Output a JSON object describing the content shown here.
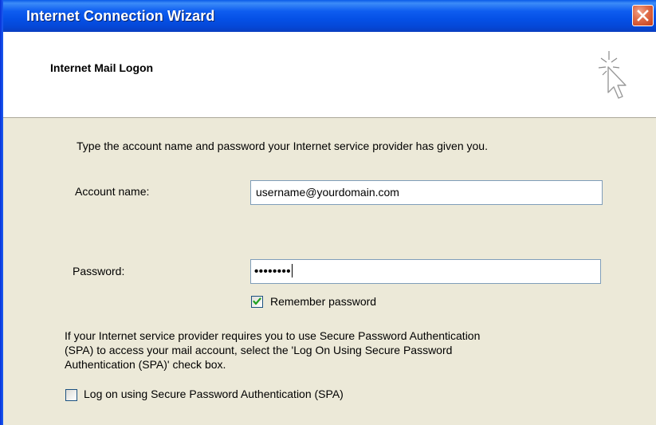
{
  "window": {
    "title": "Internet Connection Wizard",
    "close_icon": "close-icon",
    "titlebar_color": "#0550e6",
    "close_color": "#d9562f"
  },
  "header": {
    "title": "Internet Mail Logon",
    "icon": "wizard-sparkle-cursor-icon"
  },
  "form": {
    "intro": "Type the account name and password your Internet service provider has given you.",
    "account_label": "Account name:",
    "account_value": "username@yourdomain.com",
    "password_label": "Password:",
    "password_masked": "••••••••",
    "remember_label": "Remember password",
    "remember_checked": true,
    "spa_text_lines": [
      "If your Internet service provider requires you to use Secure Password Authentication",
      "(SPA) to access your mail account, select the 'Log On Using Secure Password",
      "Authentication (SPA)' check box."
    ],
    "spa_label": "Log on using Secure Password Authentication (SPA)",
    "spa_checked": false
  },
  "colors": {
    "body_background": "#ece9d8",
    "field_border": "#7f9db9",
    "check_color": "#21a121"
  }
}
